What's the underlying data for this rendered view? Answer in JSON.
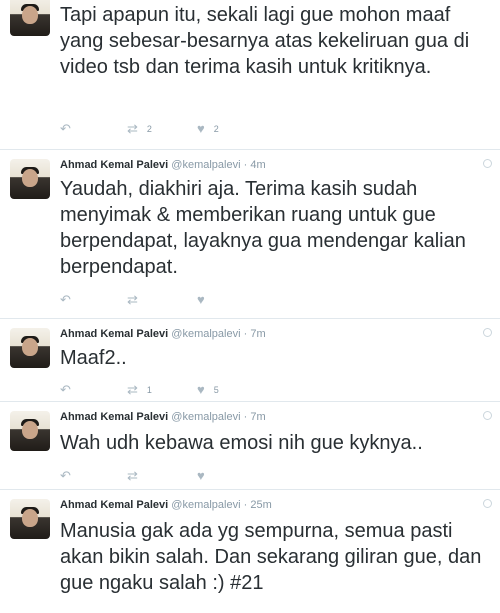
{
  "tweets": [
    {
      "name": "",
      "handle": "",
      "time": "",
      "text": "Tapi apapun itu, sekali lagi gue mohon maaf yang sebesar-besarnya atas kekeliruan gua di video tsb dan terima kasih untuk kritiknya.",
      "retweets": "2",
      "likes": "2"
    },
    {
      "name": "Ahmad Kemal Palevi",
      "handle": "@kemalpalevi",
      "sep": "·",
      "time": "4m",
      "text": "Yaudah, diakhiri aja. Terima kasih sudah menyimak & memberikan ruang untuk gue berpendapat, layaknya gua mendengar kalian berpendapat.",
      "retweets": "",
      "likes": ""
    },
    {
      "name": "Ahmad Kemal Palevi",
      "handle": "@kemalpalevi",
      "sep": "·",
      "time": "7m",
      "text": "Maaf2..",
      "retweets": "1",
      "likes": "5"
    },
    {
      "name": "Ahmad Kemal Palevi",
      "handle": "@kemalpalevi",
      "sep": "·",
      "time": "7m",
      "text": "Wah udh kebawa emosi nih gue kyknya..",
      "retweets": "",
      "likes": ""
    },
    {
      "name": "Ahmad Kemal Palevi",
      "handle": "@kemalpalevi",
      "sep": "·",
      "time": "25m",
      "text": "Manusia gak ada yg sempurna, semua pasti akan bikin salah. Dan sekarang giliran gue, dan gue ngaku salah :) #21",
      "retweets": "",
      "likes": ""
    }
  ],
  "icons": {
    "reply": "reply-icon",
    "retweet": "retweet-icon",
    "like": "heart-icon",
    "settings": "gear-icon"
  },
  "colors": {
    "text": "#292f33",
    "muted": "#8899a6",
    "icon": "#aab8c2",
    "divider": "#e1e8ed"
  }
}
